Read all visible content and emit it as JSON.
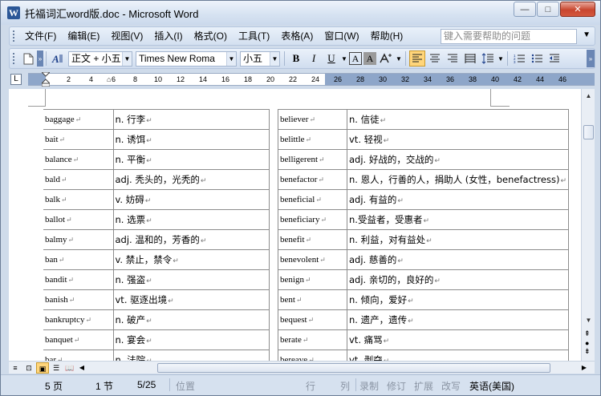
{
  "window": {
    "title": "托福词汇word版.doc - Microsoft Word",
    "app_icon": "W",
    "controls": {
      "minimize": "—",
      "maximize": "□",
      "close": "✕"
    }
  },
  "menubar": {
    "items": [
      "文件(F)",
      "编辑(E)",
      "视图(V)",
      "插入(I)",
      "格式(O)",
      "工具(T)",
      "表格(A)",
      "窗口(W)",
      "帮助(H)"
    ],
    "help_placeholder": "键入需要帮助的问题"
  },
  "toolbar": {
    "style": "正文 + 小五",
    "font": "Times New Roma",
    "size": "小五",
    "bold": "B",
    "italic": "I",
    "underline": "U",
    "char_border": "A",
    "char_shading": "A"
  },
  "ruler": {
    "ticks": [
      "2",
      "4",
      "6",
      "8",
      "10",
      "12",
      "14",
      "16",
      "18",
      "20",
      "22",
      "24",
      "26",
      "28",
      "30",
      "32",
      "34",
      "36",
      "38",
      "40",
      "42",
      "44",
      "46"
    ]
  },
  "left_table": [
    {
      "word": "baggage",
      "def": "n. 行李"
    },
    {
      "word": "bait",
      "def": "n. 诱饵"
    },
    {
      "word": "balance",
      "def": "n. 平衡"
    },
    {
      "word": "bald",
      "def": "adj. 秃头的，光秃的"
    },
    {
      "word": "balk",
      "def": "v. 妨碍"
    },
    {
      "word": "ballot",
      "def": "n. 选票"
    },
    {
      "word": "balmy",
      "def": "adj. 温和的，芳香的"
    },
    {
      "word": "ban",
      "def": "v. 禁止，禁令"
    },
    {
      "word": "bandit",
      "def": "n. 强盗"
    },
    {
      "word": "banish",
      "def": "vt. 驱逐出境"
    },
    {
      "word": "bankruptcy",
      "def": "n. 破产"
    },
    {
      "word": "banquet",
      "def": "n. 宴会"
    },
    {
      "word": "bar",
      "def": "n. 法院"
    }
  ],
  "right_table": [
    {
      "word": "believer",
      "def": "n. 信徒"
    },
    {
      "word": "belittle",
      "def": "vt. 轻视"
    },
    {
      "word": "belligerent",
      "def": "adj. 好战的，交战的"
    },
    {
      "word": "benefactor",
      "def": "n. 恩人，行善的人，捐助人 (女性，benefactress)"
    },
    {
      "word": "beneficial",
      "def": "adj. 有益的"
    },
    {
      "word": "beneficiary",
      "def": "n.受益者，受惠者"
    },
    {
      "word": "benefit",
      "def": "n. 利益，对有益处"
    },
    {
      "word": "benevolent",
      "def": "adj. 慈善的"
    },
    {
      "word": "benign",
      "def": "adj. 亲切的，良好的"
    },
    {
      "word": "bent",
      "def": "n. 倾向，爱好"
    },
    {
      "word": "bequest",
      "def": "n. 遗产，遗传"
    },
    {
      "word": "berate",
      "def": "vt. 痛骂"
    },
    {
      "word": "bereave",
      "def": "vt. 剥夺"
    }
  ],
  "statusbar": {
    "page": "5 页",
    "section": "1 节",
    "pages": "5/25",
    "position": "位置",
    "line": "行",
    "column": "列",
    "rec": "录制",
    "trk": "修订",
    "ext": "扩展",
    "ovr": "改写",
    "language": "英语(美国)"
  },
  "colors": {
    "accent": "#2b5797",
    "chrome": "#cfdbea",
    "active_button": "#ffd57a"
  }
}
